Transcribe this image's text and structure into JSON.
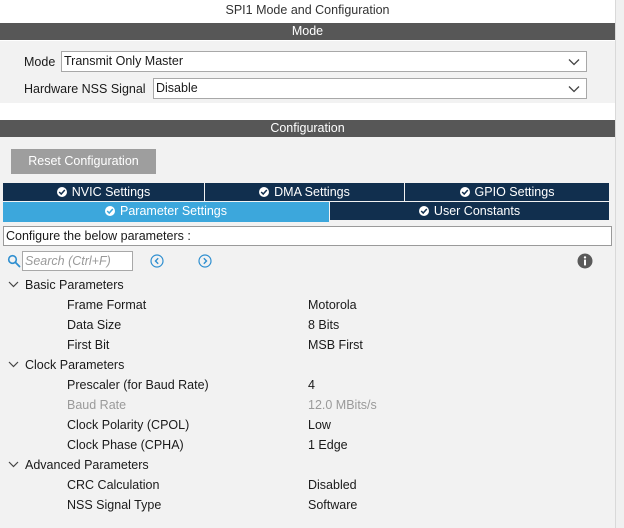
{
  "title": "SPI1 Mode and Configuration",
  "mode_section": {
    "header": "Mode",
    "mode_label": "Mode",
    "mode_value": "Transmit Only Master",
    "nss_label": "Hardware NSS Signal",
    "nss_value": "Disable"
  },
  "config_section": {
    "header": "Configuration",
    "reset_button": "Reset Configuration",
    "tabs_row1": [
      "NVIC Settings",
      "DMA Settings",
      "GPIO Settings"
    ],
    "tabs_row2": [
      "Parameter Settings",
      "User Constants"
    ],
    "active_tab": "Parameter Settings",
    "hint": "Configure the below parameters :",
    "search_placeholder": "Search (Ctrl+F)"
  },
  "groups": [
    {
      "label": "Basic Parameters",
      "params": [
        {
          "name": "Frame Format",
          "value": "Motorola",
          "disabled": false
        },
        {
          "name": "Data Size",
          "value": "8 Bits",
          "disabled": false
        },
        {
          "name": "First Bit",
          "value": "MSB First",
          "disabled": false
        }
      ]
    },
    {
      "label": "Clock Parameters",
      "params": [
        {
          "name": "Prescaler (for Baud Rate)",
          "value": "4",
          "disabled": false
        },
        {
          "name": "Baud Rate",
          "value": "12.0 MBits/s",
          "disabled": true
        },
        {
          "name": "Clock Polarity (CPOL)",
          "value": "Low",
          "disabled": false
        },
        {
          "name": "Clock Phase (CPHA)",
          "value": "1 Edge",
          "disabled": false
        }
      ]
    },
    {
      "label": "Advanced Parameters",
      "params": [
        {
          "name": "CRC Calculation",
          "value": "Disabled",
          "disabled": false
        },
        {
          "name": "NSS Signal Type",
          "value": "Software",
          "disabled": false
        }
      ]
    }
  ],
  "colors": {
    "section_bar": "#575757",
    "tab_dark": "#112f4e",
    "tab_active": "#3ca7dc",
    "panel_bg": "#f2f2f2",
    "reset_button": "#9e9e9e",
    "icon_blue": "#2f8fd0"
  },
  "icons": {
    "dropdown": "chevron-down-icon",
    "tab_check": "check-circle-icon",
    "search": "search-icon",
    "previous": "previous-icon",
    "next": "next-icon",
    "info": "info-icon",
    "group_toggle": "chevron-down-icon"
  }
}
